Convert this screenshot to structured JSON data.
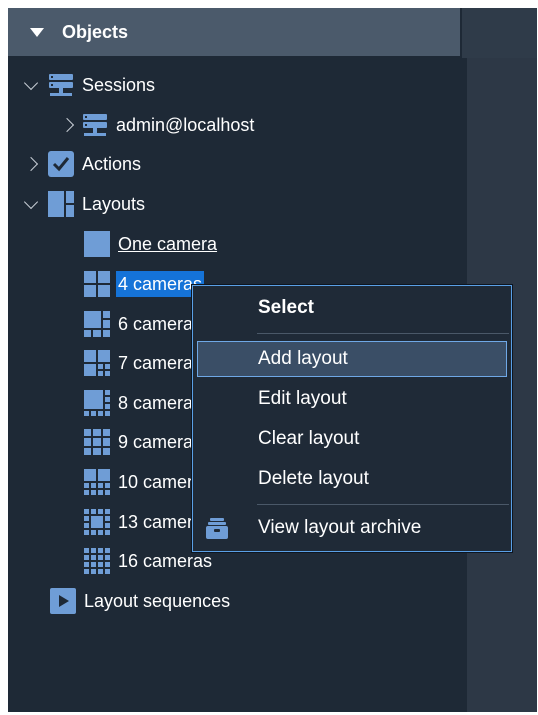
{
  "panel": {
    "title": "Objects"
  },
  "tree": {
    "sessions": "Sessions",
    "admin": "admin@localhost",
    "actions": "Actions",
    "layouts": "Layouts",
    "layout_items": [
      "One camera",
      "4 cameras",
      "6 cameras",
      "7 cameras",
      "8 cameras",
      "9 cameras",
      "10 cameras",
      "13 cameras",
      "16 cameras"
    ],
    "layout_sequences": "Layout sequences"
  },
  "context_menu": {
    "select": "Select",
    "add_layout": "Add layout",
    "edit_layout": "Edit layout",
    "clear_layout": "Clear layout",
    "delete_layout": "Delete layout",
    "view_archive": "View layout archive"
  },
  "colors": {
    "accent": "#1573d8",
    "icon_blue": "#6f9dd6",
    "background": "#1e2936",
    "header": "#4b5a6b"
  }
}
